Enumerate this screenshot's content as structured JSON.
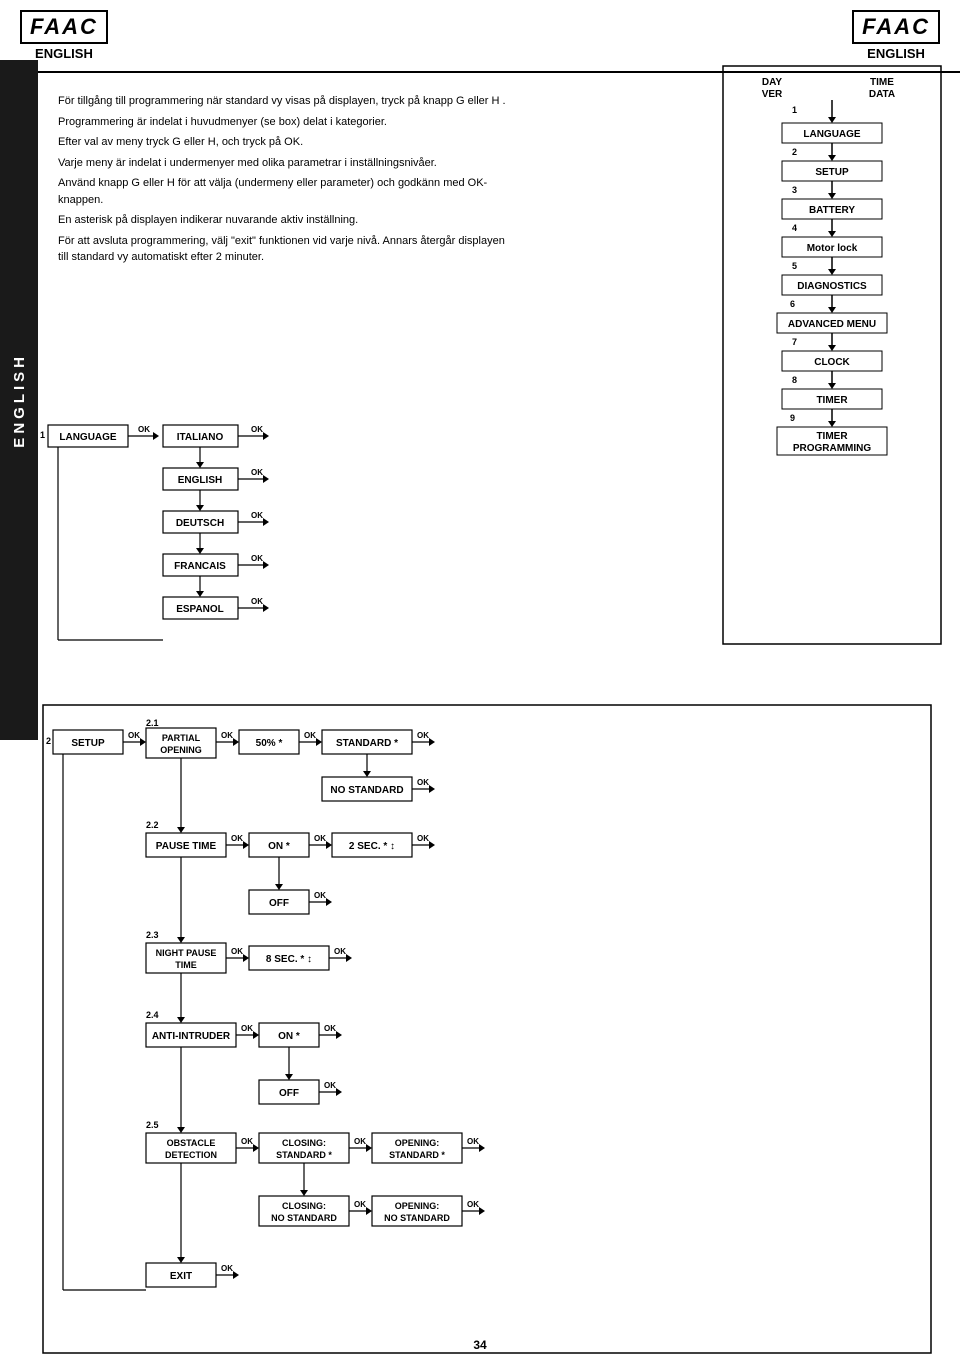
{
  "header": {
    "logo": "FAAC",
    "language": "ENGLISH"
  },
  "sidebar": {
    "label": "ENGLISH"
  },
  "intro": {
    "paragraphs": [
      "För tillgång till programmering när standard vy visas på displayen, tryck på knapp G eller H .",
      "Programmering är indelat i huvudmenyer (se box) delat i kategorier.",
      "Efter val av meny tryck  G eller H, och tryck på OK.",
      "Varje meny är indelat i undermenyer med olika parametrar i inställningsnivåer.",
      "Använd knapp G eller H för att välja (undermeny eller parameter) och godkänn med  OK-knappen.",
      "En asterisk på displayen indikerar nuvarande aktiv inställning.",
      "För att avsluta programmering, välj \"exit\" funktionen vid varje nivå. Annars återgår displayen till standard vy automatiskt efter 2 minuter."
    ]
  },
  "menu_diagram": {
    "header_left": "DAY\nVER",
    "header_right": "TIME\nDATA",
    "items": [
      {
        "num": "1",
        "label": "LANGUAGE"
      },
      {
        "num": "2",
        "label": "SETUP"
      },
      {
        "num": "3",
        "label": "BATTERY"
      },
      {
        "num": "4",
        "label": "Motor lock"
      },
      {
        "num": "5",
        "label": "DIAGNOSTICS"
      },
      {
        "num": "6",
        "label": "ADVANCED MENU"
      },
      {
        "num": "7",
        "label": "CLOCK"
      },
      {
        "num": "8",
        "label": "TIMER"
      },
      {
        "num": "9",
        "label": "TIMER\nPROGRAMMING"
      }
    ]
  },
  "language_flow": {
    "start_num": "1",
    "start_label": "LANGUAGE",
    "ok1": "OK",
    "items": [
      {
        "label": "ITALIANO",
        "ok": "OK"
      },
      {
        "label": "ENGLISH",
        "ok": "OK"
      },
      {
        "label": "DEUTSCH",
        "ok": "OK"
      },
      {
        "label": "FRANCAIS",
        "ok": "OK"
      },
      {
        "label": "ESPANOL",
        "ok": "OK"
      }
    ]
  },
  "setup_flow": {
    "start_num": "2",
    "start_label": "SETUP",
    "ok1": "OK",
    "sub_items": [
      {
        "num": "2.1",
        "label": "PARTIAL\nOPENING",
        "ok": "OK",
        "values": [
          {
            "val": "50% *",
            "ok": "OK",
            "options": [
              {
                "val": "STANDARD *",
                "ok": "OK"
              },
              {
                "val": "NO STANDARD",
                "ok": "OK"
              }
            ]
          }
        ]
      },
      {
        "num": "2.2",
        "label": "PAUSE TIME",
        "ok": "OK",
        "values": [
          {
            "val": "ON *",
            "ok": "OK",
            "options": [
              {
                "val": "2 SEC. * ↕",
                "ok": "OK"
              }
            ]
          },
          {
            "val": "OFF",
            "ok": "OK"
          }
        ]
      },
      {
        "num": "2.3",
        "label": "NIGHT PAUSE\nTIME",
        "ok": "OK",
        "values": [
          {
            "val": "8 SEC. * ↕",
            "ok": "OK"
          }
        ]
      },
      {
        "num": "2.4",
        "label": "ANTI-INTRUDER",
        "ok": "OK",
        "values": [
          {
            "val": "ON *",
            "ok": "OK"
          },
          {
            "val": "OFF",
            "ok": "OK"
          }
        ]
      },
      {
        "num": "2.5",
        "label": "OBSTACLE\nDETECTION",
        "ok": "OK",
        "values": [
          {
            "val": "CLOSING:\nSTANDARD *",
            "ok": "OK",
            "sub": {
              "val": "OPENING:\nSTANDARD *",
              "ok": "OK"
            }
          },
          {
            "val": "CLOSING:\nNO STANDARD",
            "ok": "OK",
            "sub": {
              "val": "OPENING:\nNO STANDARD",
              "ok": "OK"
            }
          }
        ]
      },
      {
        "num": "",
        "label": "EXIT",
        "ok": "OK"
      }
    ]
  },
  "page_number": "34"
}
